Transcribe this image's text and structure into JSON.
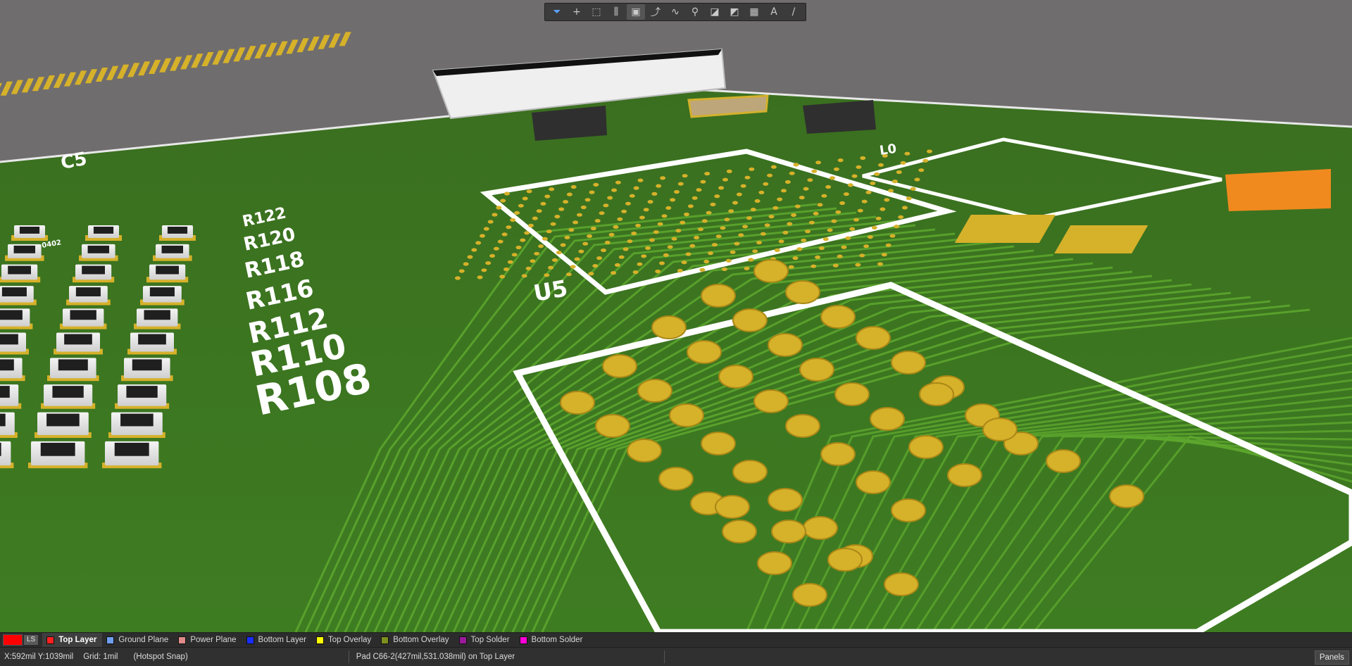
{
  "toolbar": {
    "tools": [
      {
        "name": "filter-icon",
        "glyph": "⏷"
      },
      {
        "name": "cross-icon",
        "glyph": "+"
      },
      {
        "name": "select-rect-icon",
        "glyph": "⬚"
      },
      {
        "name": "align-icon",
        "glyph": "⫼"
      },
      {
        "name": "component-icon",
        "glyph": "▣"
      },
      {
        "name": "route-icon",
        "glyph": "⤴"
      },
      {
        "name": "diff-pair-icon",
        "glyph": "∿"
      },
      {
        "name": "via-icon",
        "glyph": "⚲"
      },
      {
        "name": "polygon-icon",
        "glyph": "◪"
      },
      {
        "name": "region-icon",
        "glyph": "◩"
      },
      {
        "name": "chart-icon",
        "glyph": "▦"
      },
      {
        "name": "text-icon",
        "glyph": "A"
      },
      {
        "name": "line-icon",
        "glyph": "/"
      }
    ]
  },
  "layers": {
    "ls_label": "LS",
    "current_color": "#ff0000",
    "items": [
      {
        "label": "Top Layer",
        "color": "#ff2020",
        "active": true
      },
      {
        "label": "Ground Plane",
        "color": "#6f9ef0"
      },
      {
        "label": "Power Plane",
        "color": "#e08a8a"
      },
      {
        "label": "Bottom Layer",
        "color": "#1a2cff"
      },
      {
        "label": "Top Overlay",
        "color": "#ffff00"
      },
      {
        "label": "Bottom Overlay",
        "color": "#7f8f1f"
      },
      {
        "label": "Top Solder",
        "color": "#9b1a9b"
      },
      {
        "label": "Bottom Solder",
        "color": "#ff00d8"
      }
    ]
  },
  "status": {
    "coords": "X:592mil Y:1039mil",
    "grid": "Grid: 1mil",
    "snap": "(Hotspot Snap)",
    "message": "Pad C66-2(427mil,531.038mil) on Top Layer",
    "panels": "Panels"
  },
  "board": {
    "colors": {
      "background": "#6f6d6d",
      "board": "#3f7a22",
      "trace": "#5ea82e",
      "pad": "#d6b12a",
      "silk": "#ffffff"
    },
    "silk_labels": [
      "R108",
      "R110",
      "R112",
      "R116",
      "R118",
      "R120",
      "R122",
      "C5",
      "U5",
      "0402",
      "L0"
    ]
  }
}
